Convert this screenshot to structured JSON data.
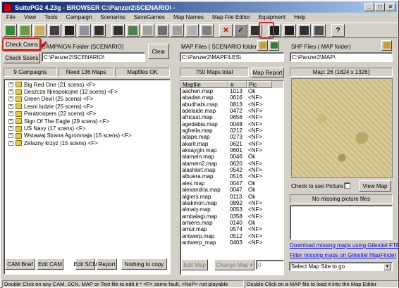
{
  "window": {
    "title": "SuitePG2 4.23g  -  BROWSER  C:\\Panzer2\\SCENARIO\\  -"
  },
  "menu": [
    "File",
    "View",
    "Tools",
    "Campaign",
    "Scenarios",
    "SaveGames",
    "Map Names",
    "Map File Editor",
    "Equipment",
    "Help"
  ],
  "toolbar_icons": [
    "campaign-icon",
    "scenario-icon",
    "map-icon",
    "picture-icon",
    "equipment-icon",
    "save-icon",
    "disk-icon",
    "report-icon",
    "edit-icon",
    "export-icon",
    "folder-icon",
    "refresh-icon",
    "wrench-icon",
    "check-icon",
    "close-icon",
    "settings-icon",
    "calc-icon",
    "star-icon",
    "grid-icon",
    "help-icon"
  ],
  "left": {
    "check_cams": "Check Cams",
    "check_scens": "Check Scens",
    "folder_label": "CAMPAIGN Folder (SCENARIO)",
    "folder_path": "C:\\Panzer2\\SCENARIO\\",
    "clear": "Clear",
    "campaigns_count": "9 Campaigns",
    "need_maps": "Need 136 Maps",
    "mapfiles_ok": "Mapfiles OK",
    "campaigns": [
      "Big Red One  (21 scens)  <F>",
      "Deszcze Niespokojne (12 scens)  <F>",
      "Green Devil  (25 scens)  <F>",
      "Lesni ludzie  (25 scens)  <F>",
      "Paratroopers  (22 scens)  <F>",
      "Sign Of The Eagle  (29 scens)  <F>",
      "US Navy  (17 scens)  <F>",
      "Wstawaj Strana Agromnaja  (15 scens)  <F>",
      "Zelazny krzyz  (15 scens)  <F>"
    ],
    "buttons": {
      "cam_brief": "CAM Brief",
      "edit_cam": "Edit CAM",
      "edit_scn": "Edit SCN",
      "report": "Report",
      "nothing": "Nothing to copy"
    }
  },
  "middle": {
    "folder_label": "MAP Files ( SCENARIO folder)",
    "folder_path": "C:\\Panzer2\\MAPFILES\\",
    "maps_total": "750 Maps total",
    "map_report": "Map Report",
    "columns": [
      "Mapfile",
      "#",
      "Pic"
    ],
    "rows": [
      [
        "aachen.map",
        "1013",
        "Ok"
      ],
      [
        "abadan.map",
        "0616",
        "<NF>"
      ],
      [
        "abudhabi.map",
        "0813",
        "<NF>"
      ],
      [
        "adelaide.map",
        "0472",
        "<NF>"
      ],
      [
        "africast.map",
        "0656",
        "<NF>"
      ],
      [
        "agedabia.map",
        "0048",
        "<NF>"
      ],
      [
        "agheila.map",
        "0212",
        "<NF>"
      ],
      [
        "aitape.map",
        "0273",
        "<NF>"
      ],
      [
        "akarit.map",
        "0621",
        "<NF>"
      ],
      [
        "aksaygin.map",
        "0601",
        "<NF>"
      ],
      [
        "alamein.map",
        "0046",
        "Ok"
      ],
      [
        "alamein2.map",
        "0620",
        "<NF>"
      ],
      [
        "alashkirt.map",
        "0542",
        "<NF>"
      ],
      [
        "albuera.map",
        "0516",
        "<NF>"
      ],
      [
        "alex.map",
        "0047",
        "Ok"
      ],
      [
        "alexandria.map",
        "0047",
        "Ok"
      ],
      [
        "algiers.map",
        "0113",
        "Ok"
      ],
      [
        "aliakmon.map",
        "0892",
        "<NF>"
      ],
      [
        "almaty.map",
        "0053",
        "<NF>"
      ],
      [
        "ambalagi.map",
        "0358",
        "<NF>"
      ],
      [
        "amiens.map",
        "0140",
        "Ok"
      ],
      [
        "amur.map",
        "0574",
        "<NF>"
      ],
      [
        "antwerp.map",
        "0512",
        "<NF>"
      ],
      [
        "antwerp_map",
        "0403",
        "<NF>"
      ]
    ],
    "edit_map": "Edit Map",
    "change_map": "Change Map #",
    "change_value": "0"
  },
  "right": {
    "folder_label": "SHP Files ( MAP  folder)",
    "folder_path": "C:\\Panzer2\\MAP\\",
    "map_info": "Map: 26 (1824 x 1326)",
    "check_picture": "Check to see Picture",
    "view_map": "View Map",
    "no_missing": "No missing picture files",
    "link1": "Download missing maps using Gilestiel FTP",
    "link2": "Filter missing maps on Gilestiel MapFinder",
    "select_site": "Select Map Site to go"
  },
  "status": {
    "left": "Double Click on any CAM, SCN, MAP or Text file to edit it  * <F> some fault,  <NoP> not playable",
    "right": "Double Click on a MAP file to load it into the Map Editor"
  },
  "colors": {
    "titlebar": "#0a246a",
    "highlight": "#d02020",
    "link": "#0000ff"
  }
}
